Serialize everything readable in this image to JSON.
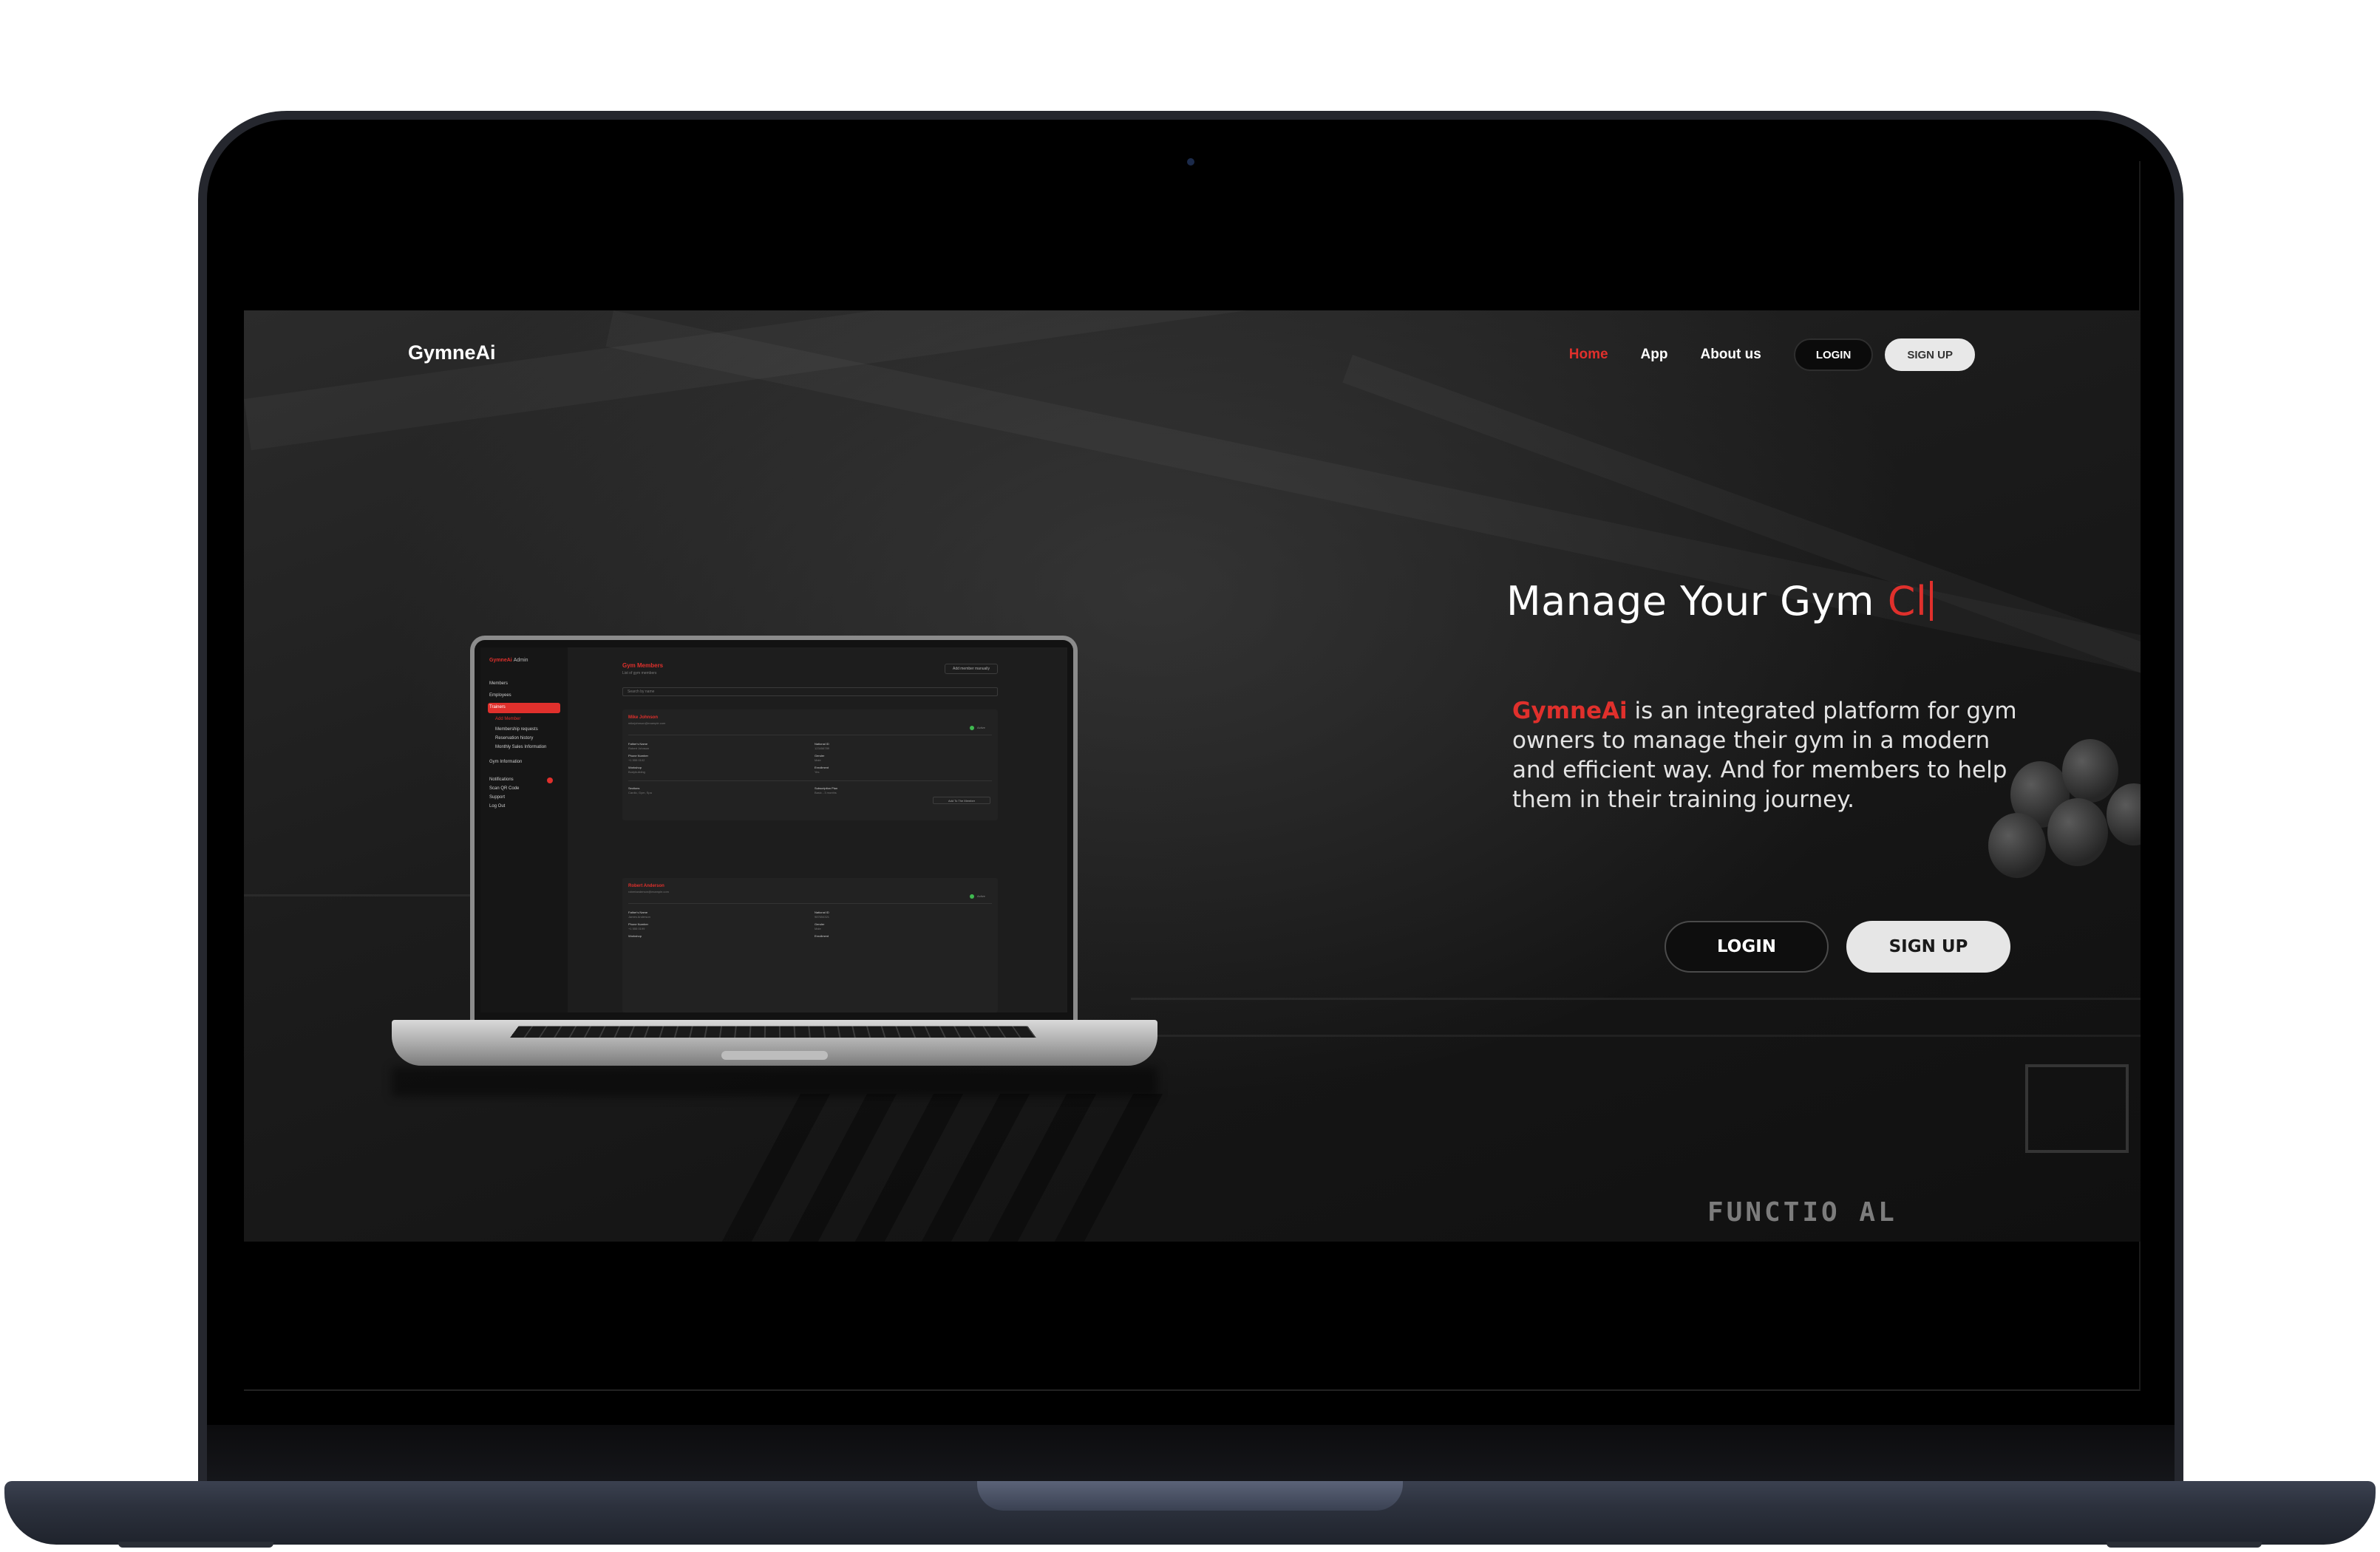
{
  "site": {
    "logo": "GymneAi",
    "nav": {
      "home": "Home",
      "app": "App",
      "about": "About us",
      "login": "LOGIN",
      "signup": "SIGN UP"
    },
    "headline": {
      "static": "Manage Your Gym ",
      "typed": "Cl"
    },
    "description": {
      "brand": "GymneAi",
      "text": " is an integrated platform for gym owners to manage their gym in a modern and efficient way. And for members to help them in their training journey."
    },
    "cta": {
      "login": "LOGIN",
      "signup": "SIGN UP"
    },
    "background_text": "FUNCTIO  AL",
    "accent_color": "#e0302c"
  },
  "app_preview": {
    "brand": "GymneAi",
    "brand_suffix": "Admin",
    "sidebar": [
      "Members",
      "Employees",
      "Trainers",
      "Add Member",
      "Membership requests",
      "Reservation history",
      "Monthly Sales Information",
      "Gym Information",
      "Notifications",
      "Scan QR Code",
      "Support",
      "Log Out"
    ],
    "title": "Gym Members",
    "subtitle": "List of gym members",
    "top_button": "Add member manually",
    "search_placeholder": "Search by name",
    "cards": [
      {
        "name": "Mike Johnson",
        "email": "mikejohnson@example.com",
        "status": "Active",
        "fields": [
          {
            "label": "Father's Name",
            "value": "Robert Johnson"
          },
          {
            "label": "National ID",
            "value": "123456789"
          },
          {
            "label": "Phone Number",
            "value": "+1 555 0102"
          },
          {
            "label": "Gender",
            "value": "Male"
          },
          {
            "label": "Workshop",
            "value": "Bodybuilding"
          },
          {
            "label": "Enrollment",
            "value": "Yes"
          },
          {
            "label": "Sections",
            "value": "Cardio, Gym, Spa"
          },
          {
            "label": "Subscription Plan",
            "value": "Basic - 3 months"
          }
        ],
        "button": "Add To The Member"
      },
      {
        "name": "Robert Anderson",
        "email": "robertanderson@example.com",
        "status": "Active",
        "fields": [
          {
            "label": "Father's Name",
            "value": "James Anderson"
          },
          {
            "label": "National ID",
            "value": "987654321"
          },
          {
            "label": "Phone Number",
            "value": "+1 555 0199"
          },
          {
            "label": "Gender",
            "value": "Male"
          },
          {
            "label": "Workshop",
            "value": ""
          },
          {
            "label": "Enrollment",
            "value": ""
          }
        ]
      }
    ]
  }
}
